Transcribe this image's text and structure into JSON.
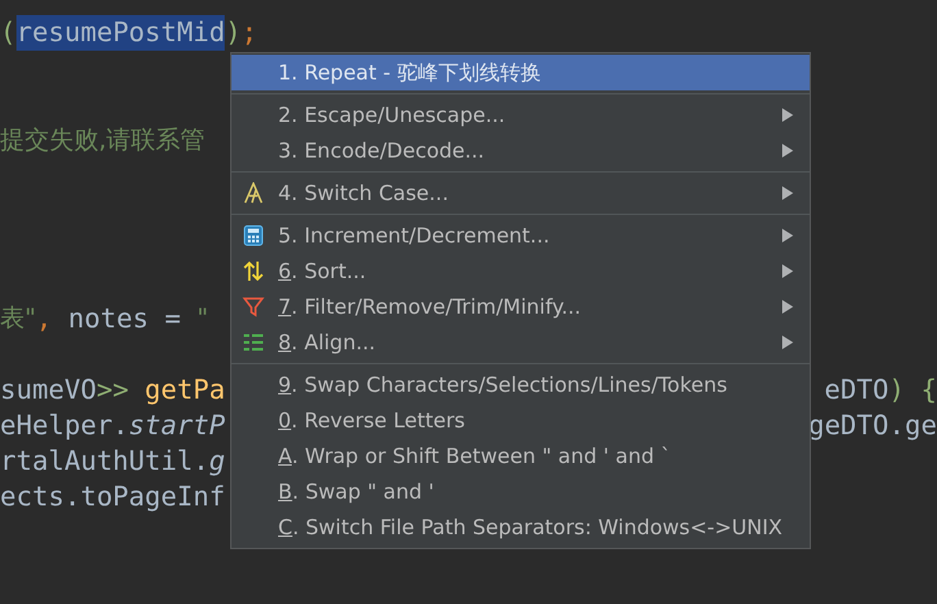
{
  "editor": {
    "lines": [
      {
        "left": [
          {
            "text": "(",
            "kind": "bracket"
          },
          {
            "text": "resumePostMid",
            "kind": "selected"
          },
          {
            "text": ")",
            "kind": "bracket"
          },
          {
            "text": ";",
            "kind": "punct"
          }
        ]
      },
      {
        "left": [
          {
            "text": "提交失败,请联系管",
            "kind": "string"
          }
        ]
      },
      {
        "left": [
          {
            "text": "表\"",
            "kind": "string"
          },
          {
            "text": ",",
            "kind": "punct"
          },
          {
            "text": " notes = ",
            "kind": "plain"
          },
          {
            "text": "\"",
            "kind": "string"
          }
        ]
      },
      {
        "left": [
          {
            "text": "sumeVO",
            "kind": "plain"
          },
          {
            "text": ">>",
            "kind": "bracket"
          },
          {
            "text": " getPa",
            "kind": "method"
          }
        ],
        "right": [
          {
            "text": "eDTO",
            "kind": "plain"
          },
          {
            "text": ")",
            "kind": "bracket"
          },
          {
            "text": " {",
            "kind": "bracket"
          }
        ]
      },
      {
        "left": [
          {
            "text": "eHelper.",
            "kind": "plain"
          },
          {
            "text": "startP",
            "kind": "static"
          }
        ],
        "right": [
          {
            "text": "geDTO.ge",
            "kind": "plain"
          }
        ]
      },
      {
        "left": [
          {
            "text": "rtalAuthUtil.",
            "kind": "plain"
          },
          {
            "text": "g",
            "kind": "static"
          }
        ]
      },
      {
        "left": [
          {
            "text": "ects.toPageInf",
            "kind": "plain"
          }
        ]
      }
    ]
  },
  "menu": {
    "groups": [
      [
        {
          "key": "1",
          "text": ". Repeat - 驼峰下划线转换",
          "underlined": false,
          "submenu": false,
          "selected": true
        }
      ],
      [
        {
          "key": "2",
          "text": ". Escape/Unescape...",
          "underlined": false,
          "submenu": true,
          "selected": false
        },
        {
          "key": "3",
          "text": ". Encode/Decode...",
          "underlined": false,
          "submenu": true,
          "selected": false
        }
      ],
      [
        {
          "key": "4",
          "text": ". Switch Case...",
          "underlined": false,
          "submenu": true,
          "selected": false,
          "kind": "font"
        }
      ],
      [
        {
          "key": "5",
          "text": ". Increment/Decrement...",
          "underlined": false,
          "submenu": true,
          "selected": false,
          "kind": "calculator"
        },
        {
          "key": "6",
          "text": ". Sort...",
          "underlined": true,
          "submenu": true,
          "selected": false,
          "kind": "sort"
        },
        {
          "key": "7",
          "text": ". Filter/Remove/Trim/Minify...",
          "underlined": true,
          "submenu": true,
          "selected": false,
          "kind": "filter"
        },
        {
          "key": "8",
          "text": ". Align...",
          "underlined": true,
          "submenu": true,
          "selected": false,
          "kind": "align"
        }
      ],
      [
        {
          "key": "9",
          "text": ". Swap Characters/Selections/Lines/Tokens",
          "underlined": true,
          "submenu": false,
          "selected": false
        },
        {
          "key": "0",
          "text": ". Reverse Letters",
          "underlined": true,
          "submenu": false,
          "selected": false
        },
        {
          "key": "A",
          "text": ". Wrap or Shift Between \" and ' and `",
          "underlined": true,
          "submenu": false,
          "selected": false
        },
        {
          "key": "B",
          "text": ". Swap \" and '",
          "underlined": true,
          "submenu": false,
          "selected": false
        },
        {
          "key": "C",
          "text": ". Switch File Path Separators: Windows<->UNIX",
          "underlined": true,
          "submenu": false,
          "selected": false
        }
      ]
    ]
  }
}
